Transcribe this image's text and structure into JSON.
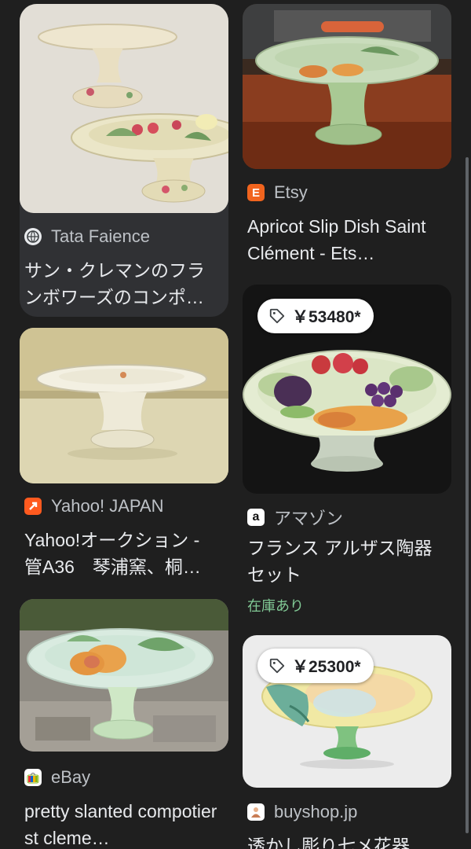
{
  "results": {
    "left": [
      {
        "source": "Tata Faience",
        "favicon": "globe-icon",
        "title": "サン・クレマンのフランボワーズのコンポ…"
      },
      {
        "source": "Yahoo! JAPAN",
        "favicon": "yahoo-auction-icon",
        "title": "Yahoo!オークション - 管A36　琴浦窯、桐…"
      },
      {
        "source": "eBay",
        "favicon": "ebay-icon",
        "title": "pretty slanted compotier st cleme…"
      }
    ],
    "right": [
      {
        "source": "Etsy",
        "favicon": "etsy-icon",
        "favicon_letter": "E",
        "title": "Apricot Slip Dish Saint Clément - Ets…"
      },
      {
        "price": "￥53480*",
        "price_icon": "tag-icon",
        "source": "アマゾン",
        "favicon": "amazon-icon",
        "favicon_letter": "a",
        "title": "フランス アルザス陶器セット",
        "stock": "在庫あり"
      },
      {
        "price": "￥25300*",
        "price_icon": "tag-icon",
        "source": "buyshop.jp",
        "favicon": "buyshop-icon",
        "title": "透かし彫り七メ花器…"
      }
    ]
  },
  "colors": {
    "background": "#1f1f1f",
    "card": "#303134",
    "text": "#e8eaed",
    "source_text": "#bdc1c6",
    "stock": "#81c995",
    "etsy": "#f1641e",
    "yahoo": "#ff5a1f"
  }
}
